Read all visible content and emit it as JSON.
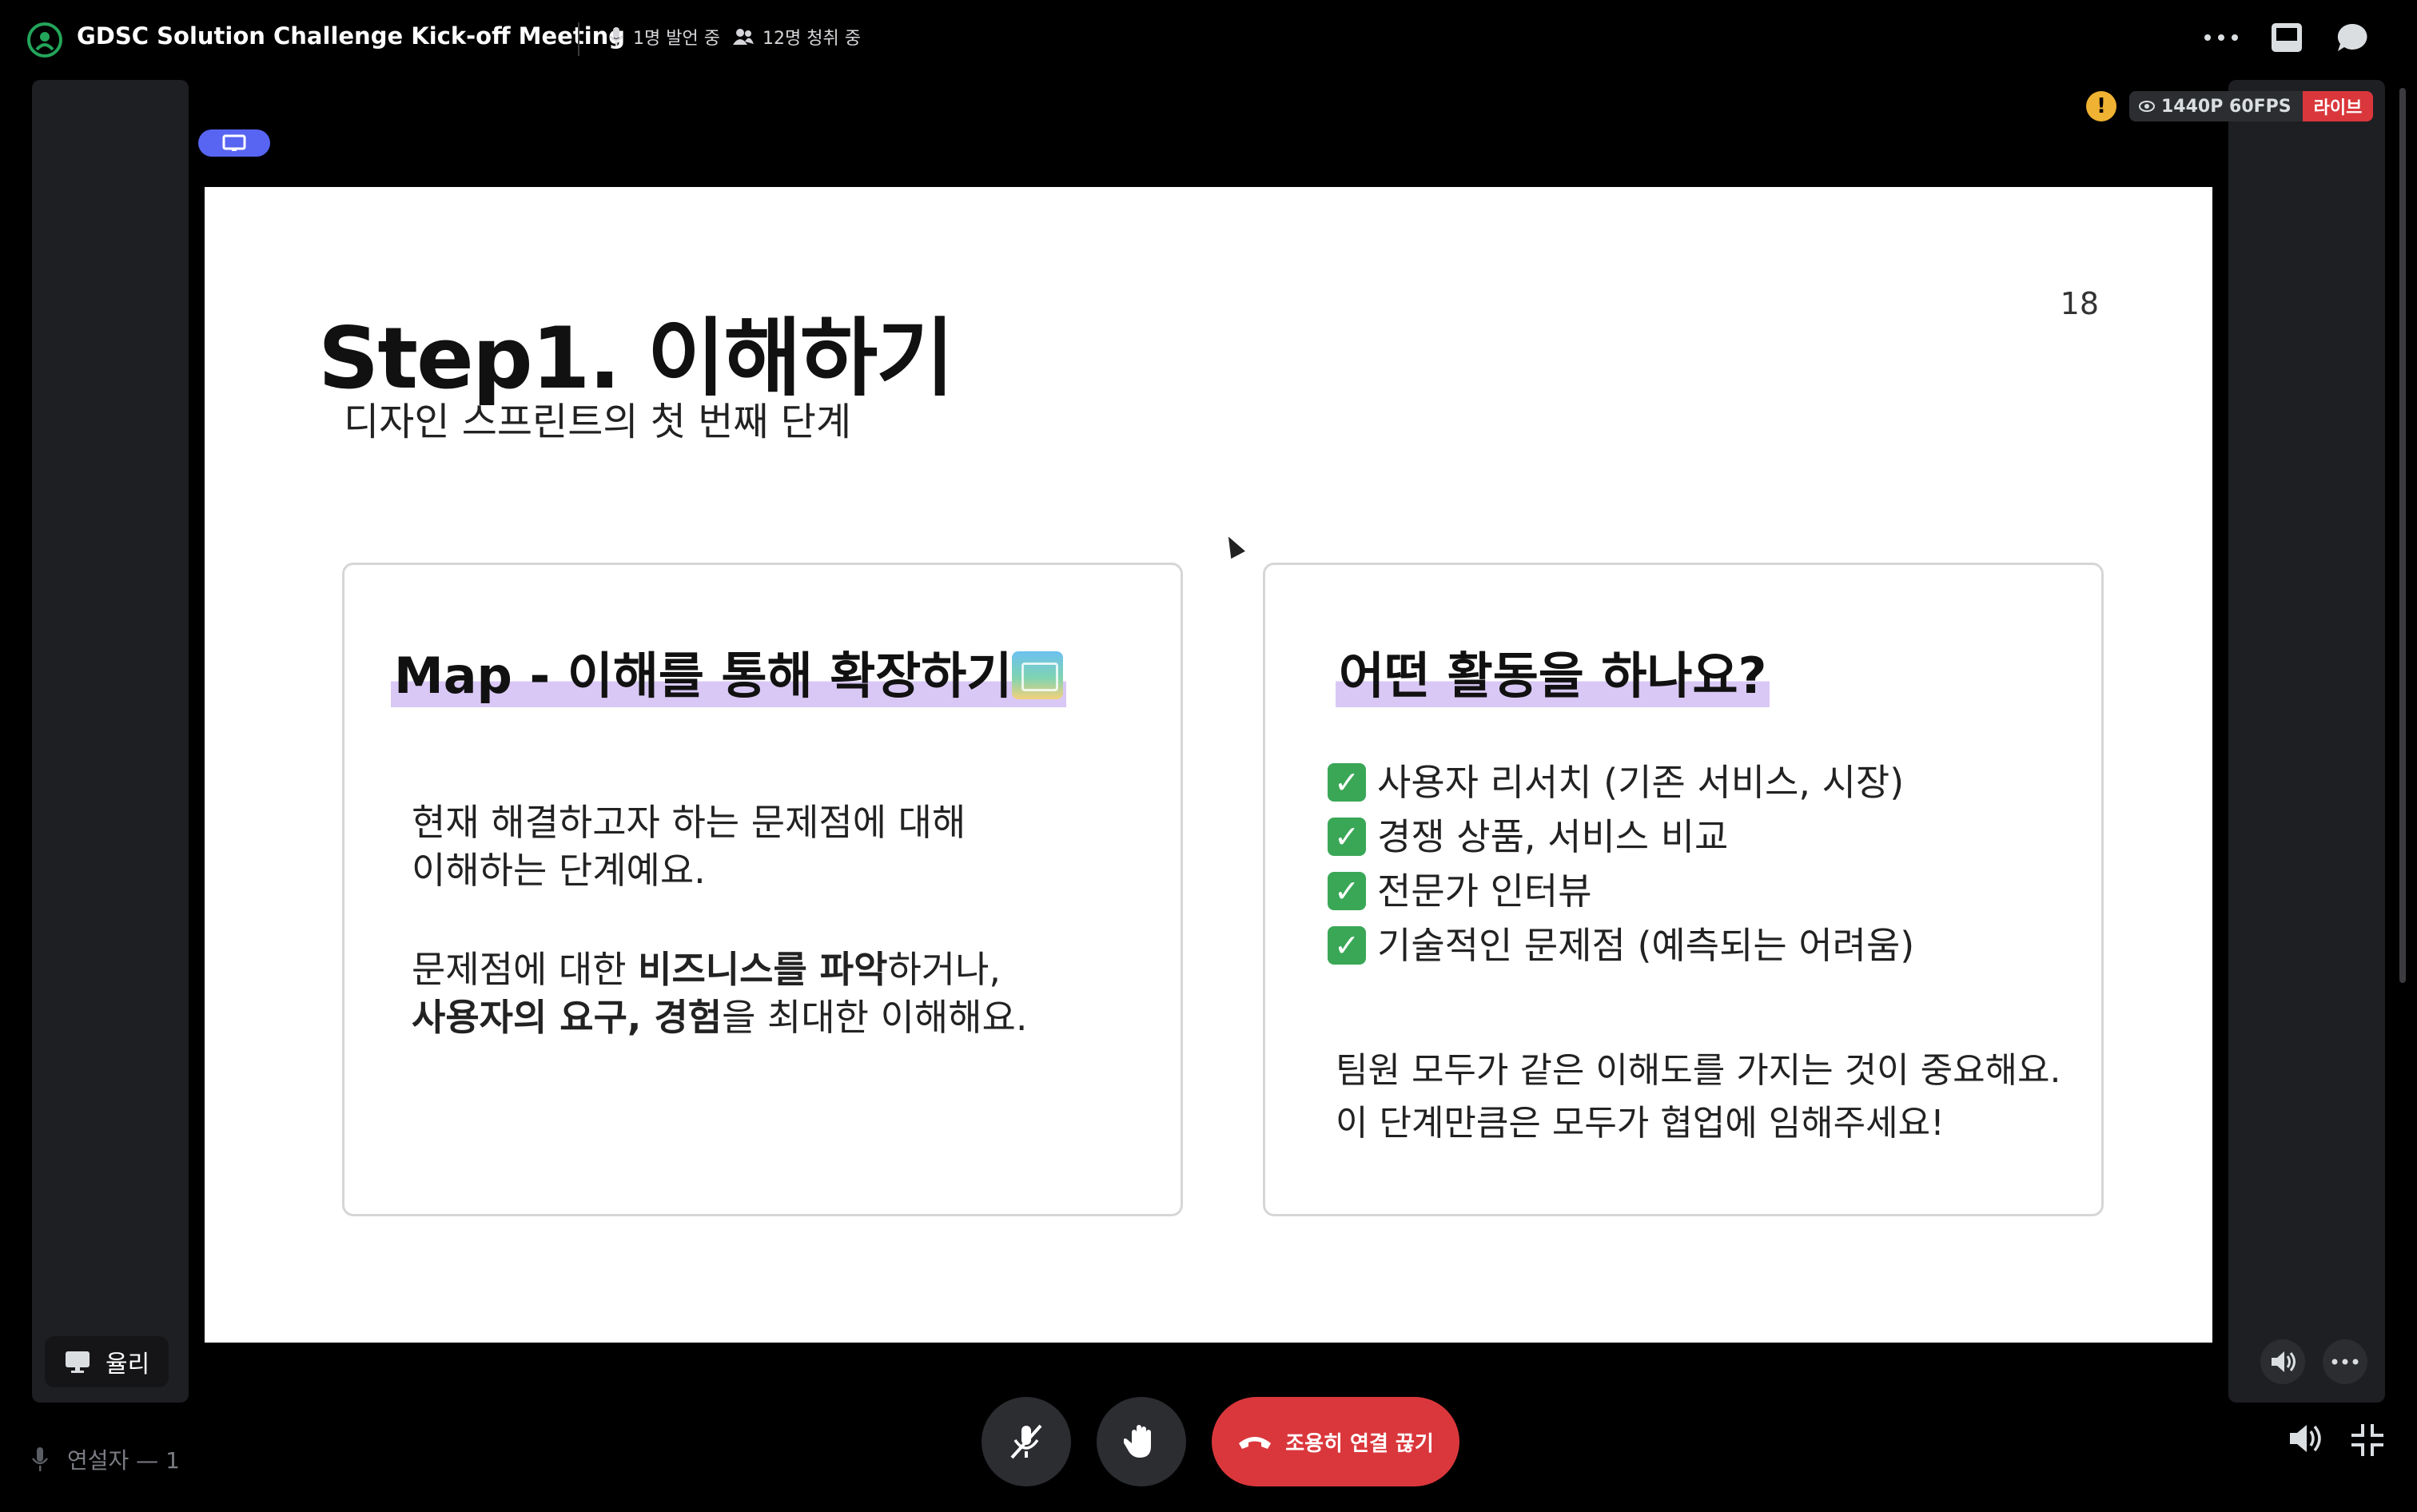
{
  "topbar": {
    "title": "GDSC Solution Challenge Kick-off Meeting",
    "speakers_stat": "1명 발언 중",
    "listeners_stat": "12명 청취 중",
    "icons": [
      "stage-icon",
      "mic-icon",
      "listeners-icon",
      "more-icon",
      "inbox-icon",
      "chat-icon"
    ]
  },
  "stream": {
    "quality": "1440P 60FPS",
    "live_label": "라이브",
    "warning": "!"
  },
  "slide": {
    "title": "Step1. 이해하기",
    "subtitle": "디자인 스프린트의 첫 번째 단계",
    "page_number": "18",
    "left_card": {
      "heading": "Map - 이해를 통해 확장하기",
      "p1_line1": "현재 해결하고자 하는 문제점에 대해",
      "p1_line2": "이해하는 단계예요.",
      "p2_line1_a": "문제점에 대한 ",
      "p2_line1_b": "비즈니스를 파악",
      "p2_line1_c": "하거나,",
      "p2_line2_a": "사용자의 요구, 경험",
      "p2_line2_b": "을 최대한 이해해요."
    },
    "right_card": {
      "heading": "어떤 활동을 하나요?",
      "checks": [
        "사용자 리서치 (기존 서비스, 시장)",
        "경쟁 상품, 서비스 비교",
        "전문가 인터뷰",
        "기술적인 문제점 (예측되는 어려움)"
      ],
      "note_line1": "팀원 모두가 같은 이해도를 가지는 것이 중요해요.",
      "note_line2": "이 단계만큼은 모두가 협업에 임해주세요!"
    }
  },
  "presenter": {
    "name": "율리"
  },
  "bottom": {
    "speakers_label": "연설자 — 1",
    "disconnect_label": "조용히 연결 끊기"
  },
  "colors": {
    "accent": "#5865f2",
    "danger": "#da373c",
    "highlight": "#d9c8f5",
    "check": "#3aa757"
  }
}
